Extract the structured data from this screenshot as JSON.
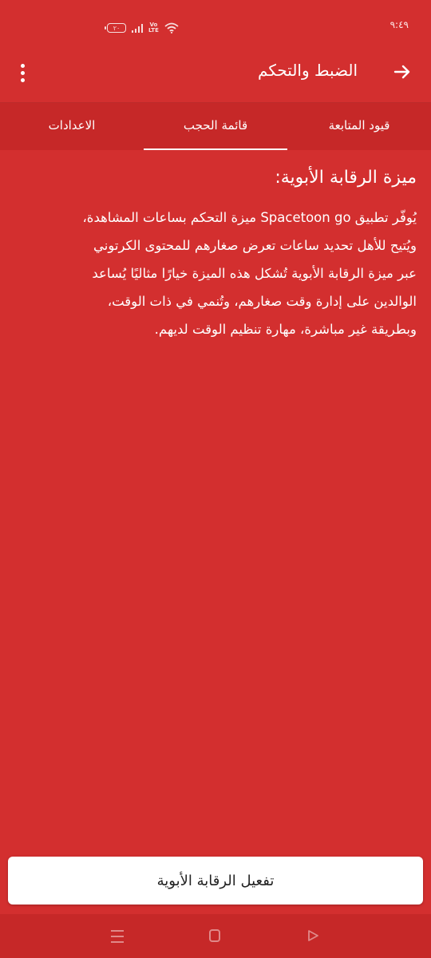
{
  "status_bar": {
    "time": "٩:٤٩",
    "battery_level": "٢٠",
    "network_type": "LTE",
    "icons": [
      "battery-icon",
      "signal-icon",
      "volte-icon",
      "wifi-icon"
    ]
  },
  "toolbar": {
    "title": "الضبط والتحكم",
    "back_icon": "arrow-right-icon",
    "menu_icon": "more-vertical-icon"
  },
  "tabs": [
    {
      "label": "قيود المتابعة",
      "active": false
    },
    {
      "label": "قائمة الحجب",
      "active": true
    },
    {
      "label": "الاعدادات",
      "active": false
    }
  ],
  "content": {
    "title": "ميزة الرقابة الأبوية:",
    "lines": [
      "يُوفّر تطبيق Spacetoon go ميزة التحكم بساعات المشاهدة،",
      "ويُتيح للأهل تحديد ساعات تعرض صغارهم للمحتوى الكرتوني",
      "عبر ميزة الرقابة الأبوية تُشكل هذه الميزة خيارًا مثاليًا يُساعد",
      "الوالدين على إدارة وقت صغارهم، وتُنمي في ذات الوقت،",
      "وبطريقة غير مباشرة، مهارة تنظيم الوقت لديهم."
    ]
  },
  "action_button": {
    "label": "تفعيل الرقابة الأبوية"
  },
  "nav_bar": {
    "icons": [
      "menu-icon",
      "home-icon",
      "back-triangle-icon"
    ]
  },
  "colors": {
    "primary": "#d32f2f",
    "tabs_bg": "#c62828",
    "button_bg": "#ffffff",
    "text": "#ffffff"
  }
}
